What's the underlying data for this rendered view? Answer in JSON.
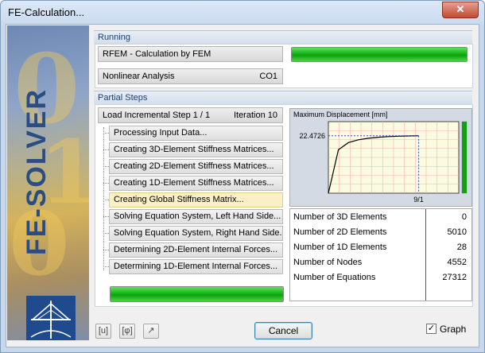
{
  "window": {
    "title": "FE-Calculation...",
    "close_glyph": "✕"
  },
  "brand": {
    "vertical_text": "FE-SOLVER",
    "watermark_digits": "0 1 0 1"
  },
  "running": {
    "header": "Running",
    "program": "RFEM - Calculation by FEM",
    "analysis_type": "Nonlinear Analysis",
    "load_case": "CO1",
    "progress": 1.0
  },
  "partial_steps": {
    "header": "Partial Steps",
    "load_step": "Load Incremental Step 1 / 1",
    "iteration": "Iteration 10",
    "steps": [
      {
        "label": "Processing Input Data...",
        "active": false
      },
      {
        "label": "Creating 3D-Element Stiffness Matrices...",
        "active": false
      },
      {
        "label": "Creating 2D-Element Stiffness Matrices...",
        "active": false
      },
      {
        "label": "Creating 1D-Element Stiffness Matrices...",
        "active": false
      },
      {
        "label": "Creating Global Stiffness Matrix...",
        "active": true
      },
      {
        "label": "Solving Equation System, Left Hand Side...",
        "active": false
      },
      {
        "label": "Solving Equation System, Right Hand Side...",
        "active": false
      },
      {
        "label": "Determining 2D-Element Internal Forces...",
        "active": false
      },
      {
        "label": "Determining 1D-Element Internal Forces...",
        "active": false
      }
    ],
    "progress": 1.0
  },
  "chart_data": {
    "type": "line",
    "title": "Maximum Displacement [mm]",
    "y_marker_label": "22.4726",
    "x_marker_label": "9/1",
    "x": [
      0,
      1,
      2,
      3,
      4,
      5,
      6,
      7,
      8,
      9
    ],
    "y": [
      0,
      17.0,
      19.8,
      20.9,
      21.5,
      21.9,
      22.15,
      22.3,
      22.4,
      22.4726
    ],
    "xlim": [
      0,
      13
    ],
    "ylim": [
      0,
      28
    ],
    "grid": true,
    "plot_bg": "#fbfbe0",
    "grid_color": "#f2b3b3",
    "line_color": "#000000",
    "marker_color": "#3050c0",
    "bar_color": "#10a010",
    "bar_level": 1.0
  },
  "stats": [
    {
      "label": "Number of 3D Elements",
      "value": "0"
    },
    {
      "label": "Number of 2D Elements",
      "value": "5010"
    },
    {
      "label": "Number of 1D Elements",
      "value": "28"
    },
    {
      "label": "Number of Nodes",
      "value": "4552"
    },
    {
      "label": "Number of Equations",
      "value": "27312"
    }
  ],
  "footer": {
    "icon_buttons": [
      {
        "name": "units-icon",
        "glyph": "[u]"
      },
      {
        "name": "phi-icon",
        "glyph": "[φ]"
      },
      {
        "name": "graph-settings-icon",
        "glyph": "↗"
      }
    ],
    "cancel_label": "Cancel",
    "graph_label": "Graph",
    "graph_checked": true
  }
}
